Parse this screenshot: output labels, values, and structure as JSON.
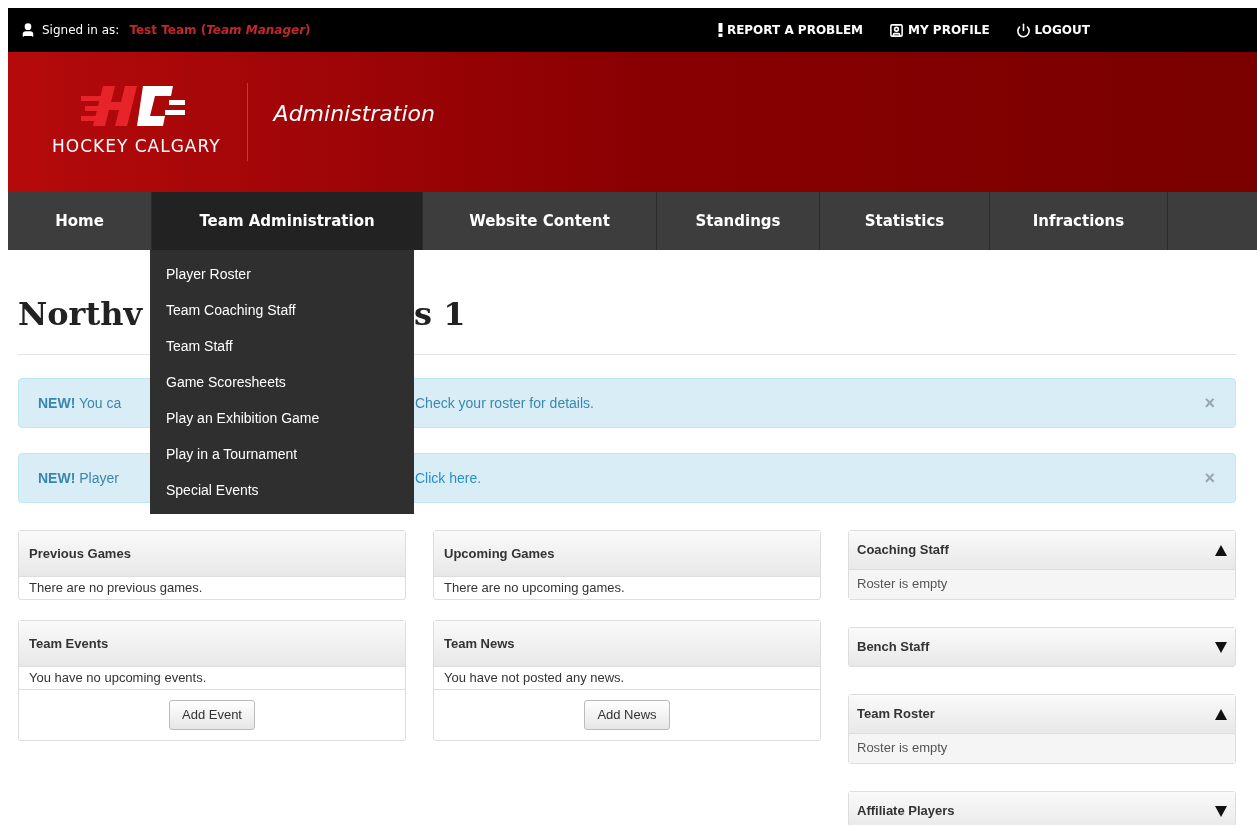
{
  "top_bar": {
    "signed_in_label": "Signed in as:",
    "user": "Test Team (*Team Manager*)",
    "links": [
      {
        "kind": "report",
        "label": "REPORT A PROBLEM"
      },
      {
        "kind": "profile",
        "label": "MY PROFILE"
      },
      {
        "kind": "logout",
        "label": "LOGOUT"
      }
    ]
  },
  "header": {
    "brand": "HOCKEY CALGARY",
    "section": "Administration"
  },
  "nav": [
    {
      "label": "Home",
      "selected": false
    },
    {
      "label": "Team Administration",
      "selected": true
    },
    {
      "label": "Website Content",
      "selected": false
    },
    {
      "label": "Standings",
      "selected": false
    },
    {
      "label": "Statistics",
      "selected": false
    },
    {
      "label": "Infractions",
      "selected": false
    }
  ],
  "dropdown": [
    "Player Roster",
    "Team Coaching Staff",
    "Team Staff",
    "Game Scoresheets",
    "Play an Exhibition Game",
    "Play in a Tournament",
    "Special Events"
  ],
  "heading": [
    "Northv",
    "s 1"
  ],
  "alerts": [
    {
      "label": "NEW!",
      "text": "You ca",
      "tail": {
        "kind": "text",
        "text": "Check your roster for details."
      },
      "close": "×"
    },
    {
      "label": "NEW!",
      "text": "Player",
      "tail": {
        "kind": "link",
        "text": "Click here."
      },
      "close": "×"
    }
  ],
  "columns": [
    [
      {
        "title": "Previous Games",
        "body": "There are no previous games."
      },
      {
        "title": "Team Events",
        "body": "You have no upcoming events.",
        "button": "Add Event"
      }
    ],
    [
      {
        "title": "Upcoming Games",
        "body": "There are no upcoming games."
      },
      {
        "title": "Team News",
        "body": "You have not posted any news.",
        "button": "Add News"
      }
    ]
  ],
  "sidebar": [
    {
      "title": "Coaching Staff",
      "expanded": true,
      "body": "Roster is empty"
    },
    {
      "title": "Bench Staff",
      "expanded": false
    },
    {
      "title": "Team Roster",
      "expanded": true,
      "body": "Roster is empty"
    },
    {
      "title": "Affiliate Players",
      "expanded": false
    }
  ]
}
